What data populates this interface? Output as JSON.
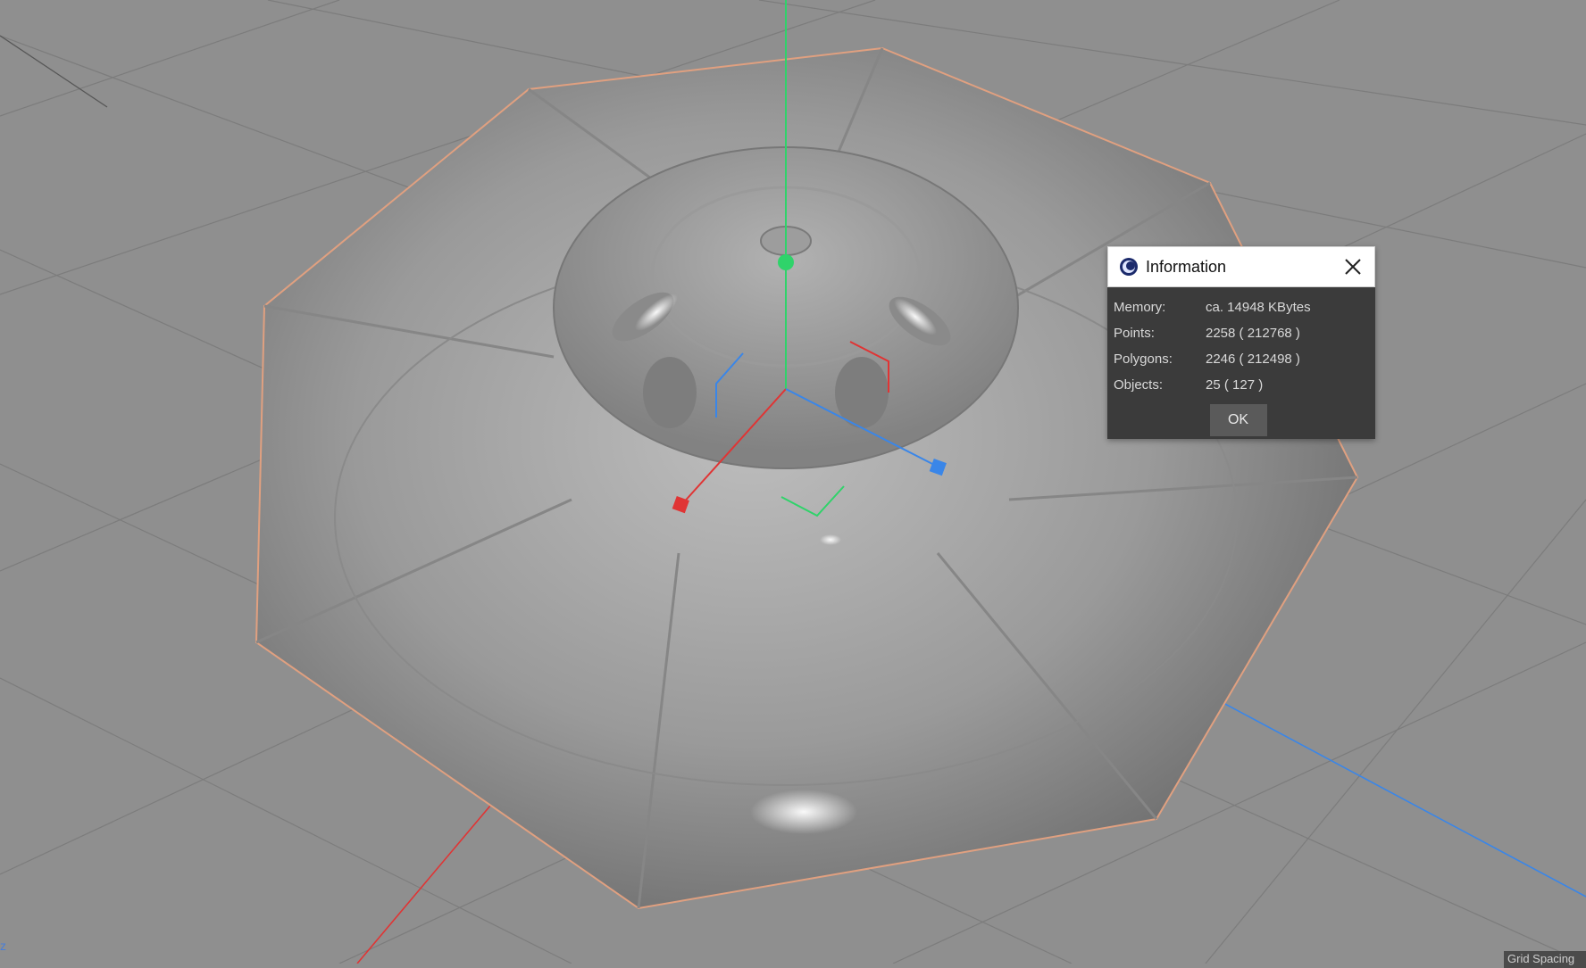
{
  "dialog": {
    "title": "Information",
    "rows": [
      {
        "label": "Memory:",
        "value": "ca. 14948 KBytes"
      },
      {
        "label": "Points:",
        "value": "2258 ( 212768 )"
      },
      {
        "label": "Polygons:",
        "value": "2246 ( 212498 )"
      },
      {
        "label": "Objects:",
        "value": "25 ( 127 )"
      }
    ],
    "ok_label": "OK"
  },
  "viewport": {
    "corner_axis_label": "z",
    "grid_spacing_label": "Grid Spacing"
  },
  "colors": {
    "background": "#8f8f8f",
    "axis_x": "#e03434",
    "axis_y": "#2fd36a",
    "axis_z": "#3a86e8",
    "selection_outline": "#e0a080"
  }
}
